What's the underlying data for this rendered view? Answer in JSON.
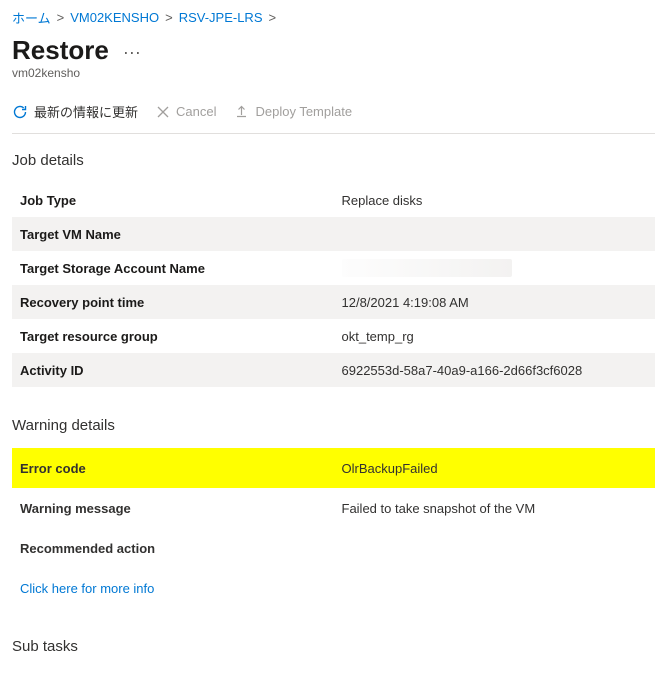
{
  "breadcrumb": {
    "home": "ホーム",
    "item1": "VM02KENSHO",
    "item2": "RSV-JPE-LRS"
  },
  "header": {
    "title": "Restore",
    "subtitle": "vm02kensho"
  },
  "toolbar": {
    "refresh": "最新の情報に更新",
    "cancel": "Cancel",
    "deploy": "Deploy Template"
  },
  "sections": {
    "job_details": "Job details",
    "warning_details": "Warning details",
    "sub_tasks": "Sub tasks"
  },
  "job": {
    "rows": [
      {
        "k": "Job Type",
        "v": "Replace disks"
      },
      {
        "k": "Target VM Name",
        "v": ""
      },
      {
        "k": "Target Storage Account Name",
        "v": ""
      },
      {
        "k": "Recovery point time",
        "v": "12/8/2021 4:19:08 AM"
      },
      {
        "k": "Target resource group",
        "v": "okt_temp_rg"
      },
      {
        "k": "Activity ID",
        "v": "6922553d-58a7-40a9-a166-2d66f3cf6028"
      }
    ]
  },
  "warning": {
    "rows": [
      {
        "k": "Error code",
        "v": "OlrBackupFailed"
      },
      {
        "k": "Warning message",
        "v": "Failed to take snapshot of the VM"
      },
      {
        "k": "Recommended action",
        "v": ""
      }
    ],
    "more_info": "Click here for more info"
  }
}
